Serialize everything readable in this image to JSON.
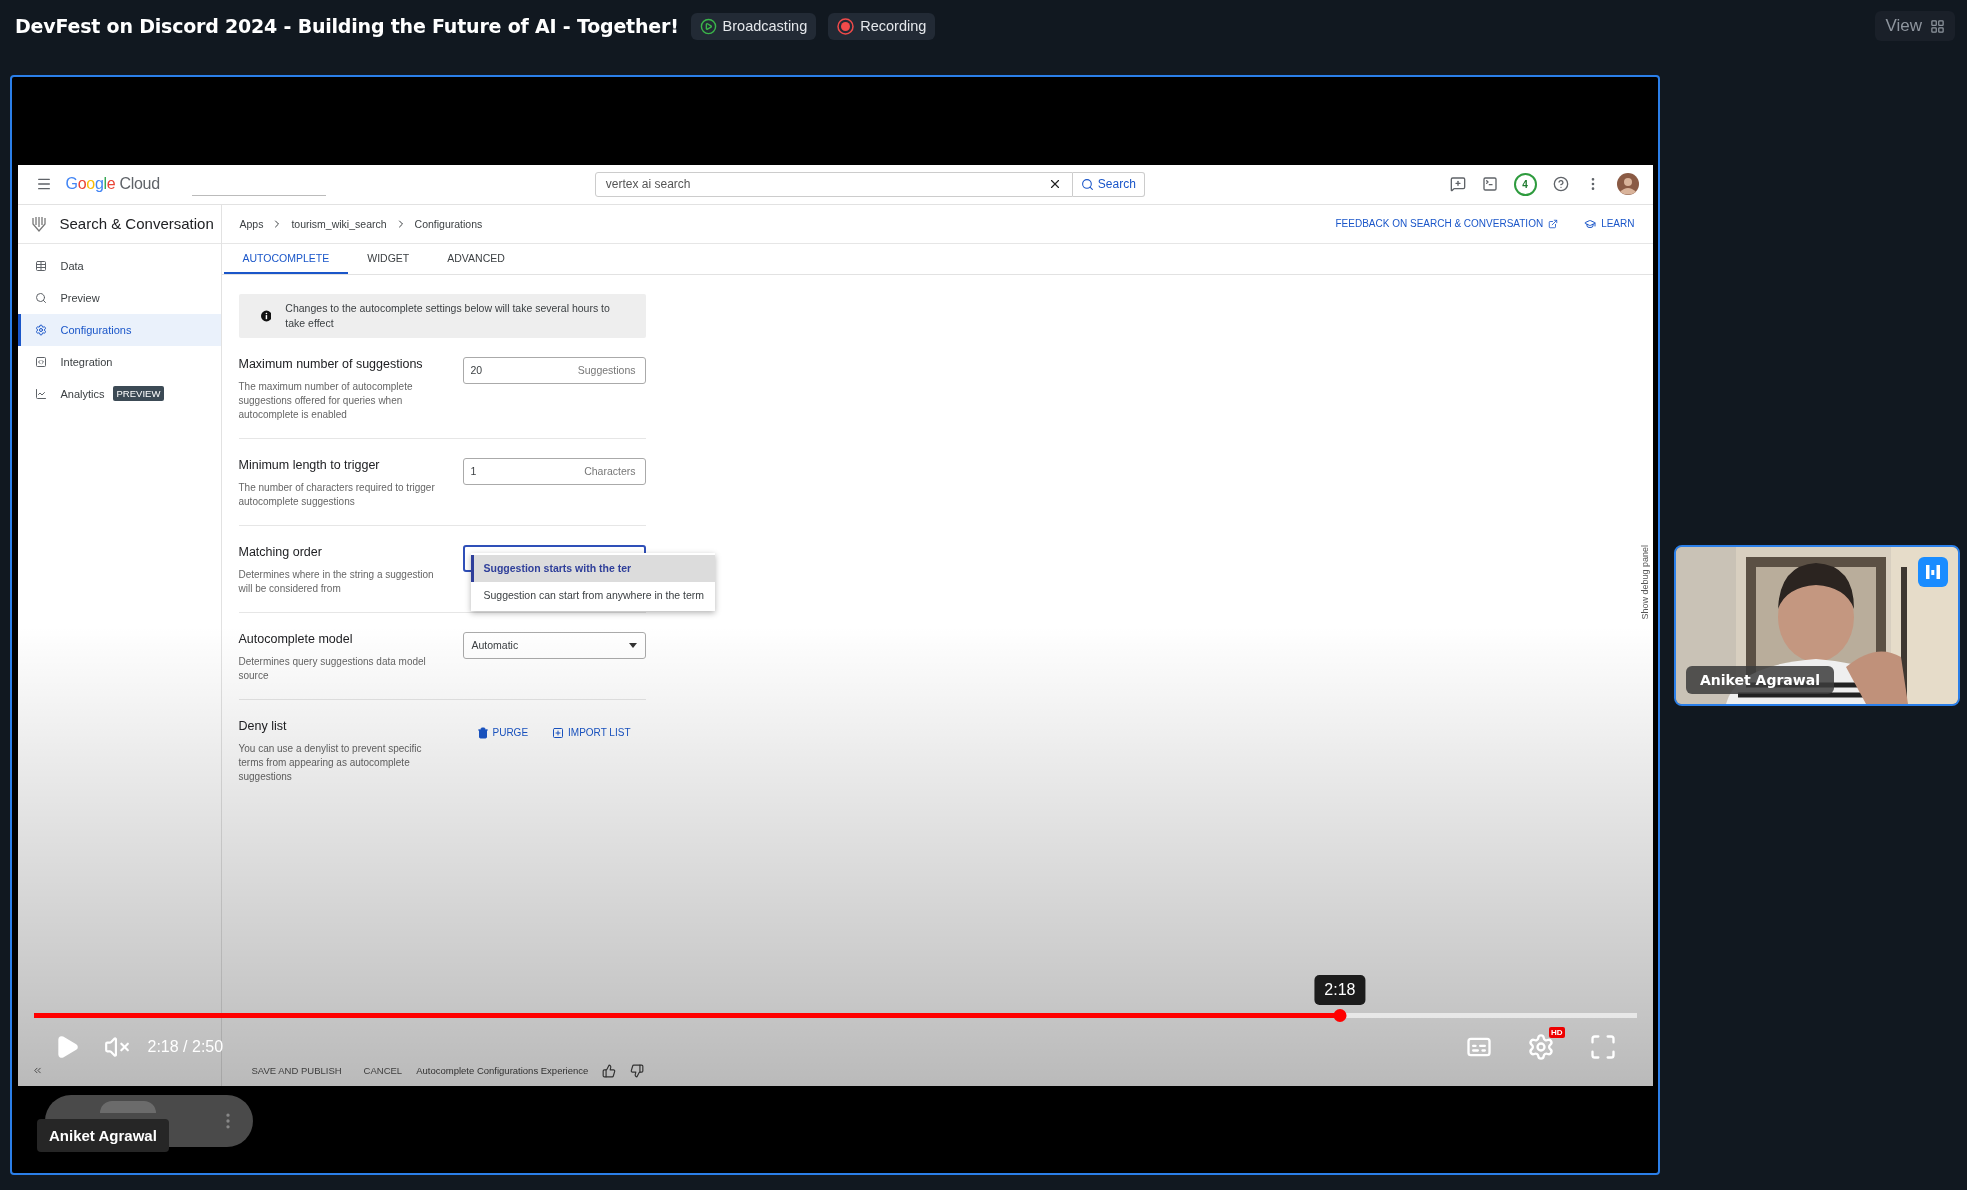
{
  "header": {
    "title": "DevFest on Discord 2024 - Building the Future of AI - Together!",
    "badges": [
      {
        "label": "Broadcasting",
        "kind": "broadcast"
      },
      {
        "label": "Recording",
        "kind": "record"
      }
    ],
    "view_button": "View"
  },
  "share": {
    "console": {
      "brand": "Google Cloud",
      "search": {
        "value": "vertex ai search",
        "button": "Search"
      },
      "notification_count": "4",
      "product": "Search & Conversation",
      "nav": [
        {
          "label": "Data",
          "selected": false
        },
        {
          "label": "Preview",
          "selected": false
        },
        {
          "label": "Configurations",
          "selected": true
        },
        {
          "label": "Integration",
          "selected": false
        },
        {
          "label": "Analytics",
          "selected": false,
          "badge": "PREVIEW"
        }
      ],
      "breadcrumbs": [
        "Apps",
        "tourism_wiki_search",
        "Configurations"
      ],
      "feedback_link": "FEEDBACK ON SEARCH & CONVERSATION",
      "learn_link": "LEARN",
      "tabs": [
        {
          "label": "AUTOCOMPLETE",
          "selected": true
        },
        {
          "label": "WIDGET",
          "selected": false
        },
        {
          "label": "ADVANCED",
          "selected": false
        }
      ],
      "notice": "Changes to the autocomplete settings below will take several hours to take effect",
      "settings": [
        {
          "kind": "number",
          "title": "Maximum number of suggestions",
          "description": "The maximum number of autocomplete suggestions offered for queries when autocomplete is enabled",
          "value": "20",
          "unit": "Suggestions"
        },
        {
          "kind": "number",
          "title": "Minimum length to trigger",
          "description": "The number of characters required to trigger autocomplete suggestions",
          "value": "1",
          "unit": "Characters"
        },
        {
          "kind": "menu",
          "title": "Matching order",
          "description": "Determines where in the string a suggestion will be considered from",
          "options": [
            {
              "label": "Suggestion starts with the ter",
              "selected": true
            },
            {
              "label": "Suggestion can start from anywhere in the term",
              "selected": false
            }
          ]
        },
        {
          "kind": "select",
          "title": "Autocomplete model",
          "description": "Determines query suggestions data model source",
          "value": "Automatic"
        },
        {
          "kind": "actions",
          "title": "Deny list",
          "description": "You can use a denylist to prevent specific terms from appearing as autocomplete suggestions",
          "actions": [
            "PURGE",
            "IMPORT LIST"
          ]
        }
      ],
      "debug_toggle": "Show debug panel",
      "footer": {
        "buttons": [
          "SAVE AND PUBLISH",
          "CANCEL"
        ],
        "feedback_label": "Autocomplete Configurations Experience"
      }
    },
    "player": {
      "progress": {
        "level": 0.815
      },
      "tooltip": "2:18",
      "time": "2:18 / 2:50",
      "muted": true,
      "hd_badge": "HD"
    }
  },
  "stage_label": "Aniket Agrawal",
  "participants": [
    {
      "name": "Aniket Agrawal",
      "kind": "picture"
    }
  ]
}
